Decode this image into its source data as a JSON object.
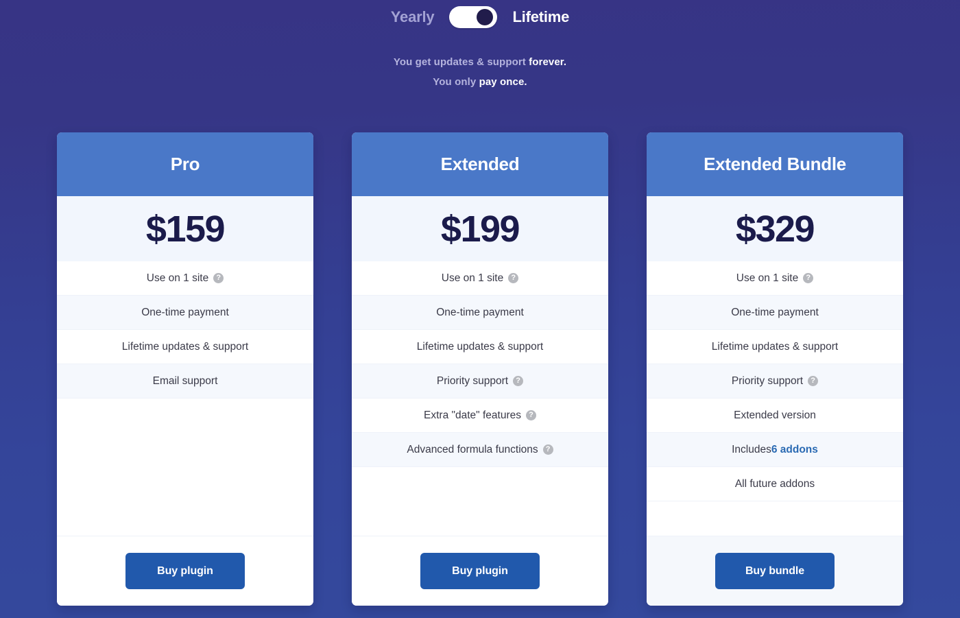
{
  "billing": {
    "left_label": "Yearly",
    "right_label": "Lifetime",
    "selected": "Lifetime",
    "toggle_icon": "toggle-switch-on-icon"
  },
  "subtitle": {
    "line1_prefix": "You get updates & support ",
    "line1_strong": "forever.",
    "line2_prefix": "You only ",
    "line2_strong": "pay once."
  },
  "colors": {
    "background_top": "#373485",
    "background_bottom": "#34499d",
    "card_header": "#4a78c8",
    "price_band": "#f2f6fd",
    "price_text": "#1b1b4b",
    "row_even": "#f5f8fd",
    "button": "#2159ac",
    "accent": "#2a6ab3",
    "help_icon": "#b6b8bd"
  },
  "help_icon_glyph": "?",
  "plans": [
    {
      "name": "Pro",
      "price": "$159",
      "features": [
        {
          "text": "Use on 1 site",
          "help": true
        },
        {
          "text": "One-time payment",
          "help": false
        },
        {
          "text": "Lifetime updates & support",
          "help": false
        },
        {
          "text": "Email support",
          "help": false
        }
      ],
      "button_label": "Buy plugin",
      "footer_tinted": false
    },
    {
      "name": "Extended",
      "price": "$199",
      "features": [
        {
          "text": "Use on 1 site",
          "help": true
        },
        {
          "text": "One-time payment",
          "help": false
        },
        {
          "text": "Lifetime updates & support",
          "help": false
        },
        {
          "text": "Priority support",
          "help": true
        },
        {
          "text": "Extra \"date\" features",
          "help": true
        },
        {
          "text": "Advanced formula functions",
          "help": true
        }
      ],
      "button_label": "Buy plugin",
      "footer_tinted": false
    },
    {
      "name": "Extended Bundle",
      "price": "$329",
      "features": [
        {
          "text": "Use on 1 site",
          "help": true
        },
        {
          "text": "One-time payment",
          "help": false
        },
        {
          "text": "Lifetime updates & support",
          "help": false
        },
        {
          "text": "Priority support",
          "help": true
        },
        {
          "text": "Extended version",
          "help": false
        },
        {
          "text": "Includes ",
          "accent": "6 addons",
          "help": false
        },
        {
          "text": "All future addons",
          "help": false
        }
      ],
      "button_label": "Buy bundle",
      "footer_tinted": true
    }
  ]
}
